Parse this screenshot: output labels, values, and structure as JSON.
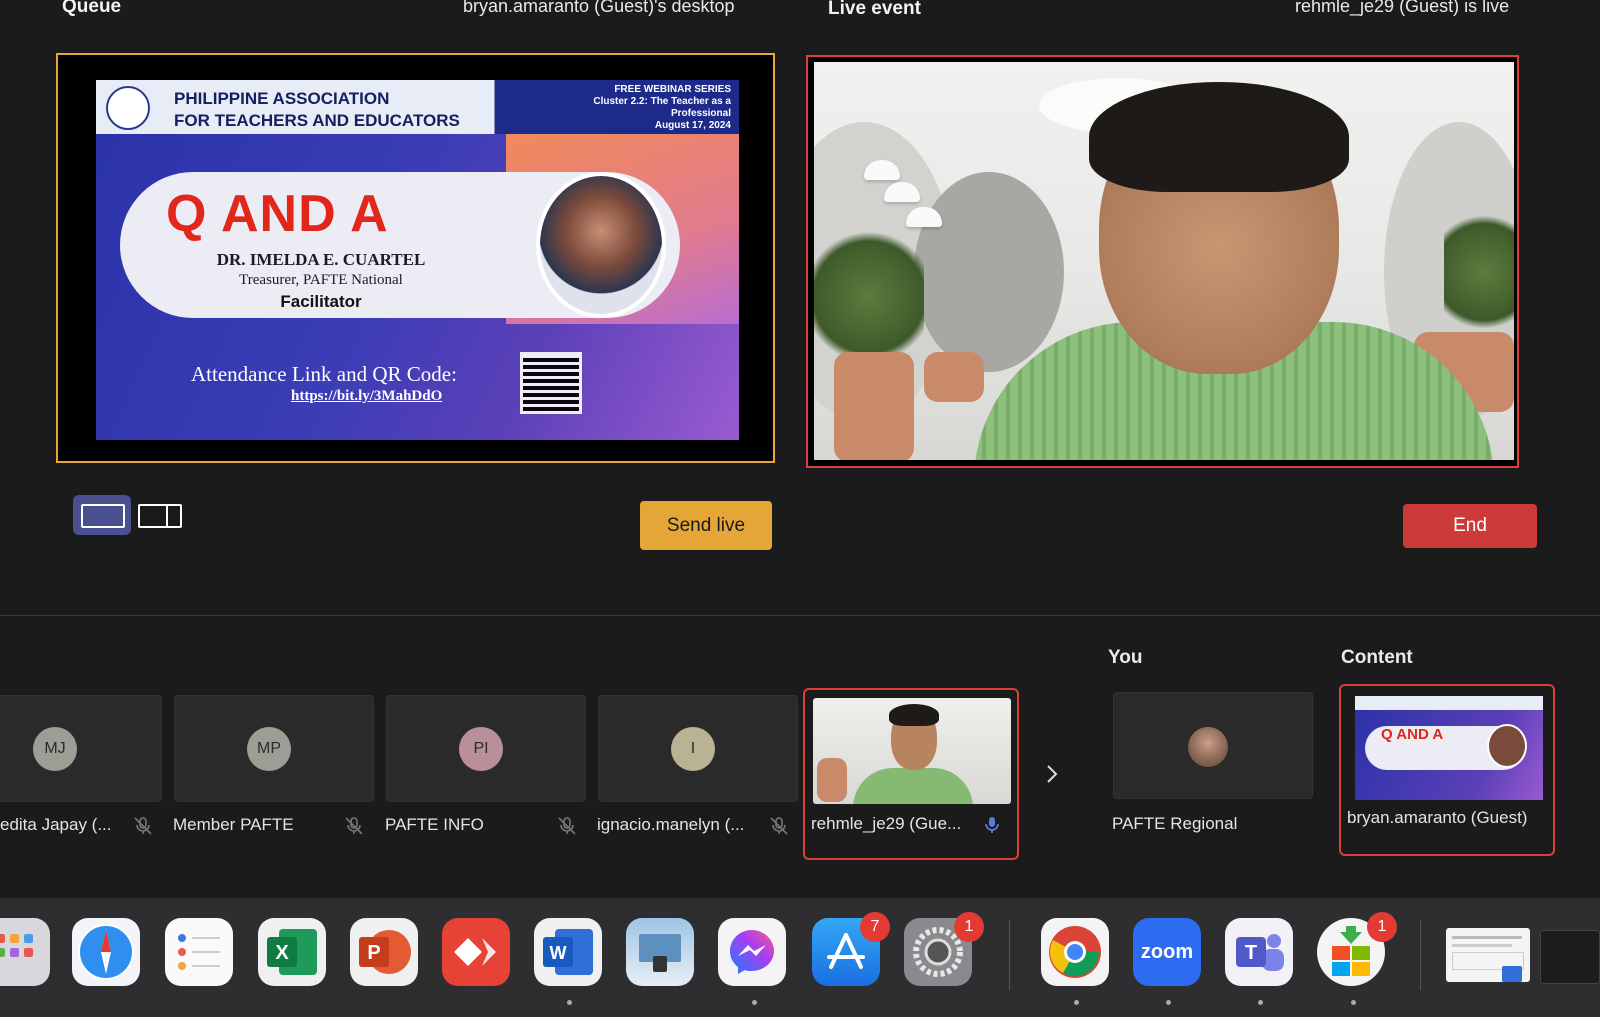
{
  "queue": {
    "title": "Queue",
    "source": "bryan.amaranto (Guest)'s desktop"
  },
  "live": {
    "title": "Live event",
    "source": "rehmle_je29 (Guest) is live"
  },
  "slide": {
    "org_line1": "PHILIPPINE ASSOCIATION",
    "org_line2": "FOR TEACHERS AND EDUCATORS",
    "series": "FREE WEBINAR SERIES\nCluster 2.2: The Teacher as a\nProfessional\nAugust 17, 2024",
    "heading": "Q AND A",
    "name": "DR. IMELDA E. CUARTEL",
    "role": "Treasurer, PAFTE National",
    "facilitator": "Facilitator",
    "attendance": "Attendance Link and QR Code:",
    "link": "https://bit.ly/3MahDdO"
  },
  "controls": {
    "send_live": "Send live",
    "end": "End"
  },
  "participants": [
    {
      "initials": "MJ",
      "name": "edita Japay (...",
      "avatar_color": "#9d9d95"
    },
    {
      "initials": "MP",
      "name": "Member PAFTE",
      "avatar_color": "#9d9d95"
    },
    {
      "initials": "PI",
      "name": "PAFTE INFO",
      "avatar_color": "#b9909a"
    },
    {
      "initials": "I",
      "name": "ignacio.manelyn (...",
      "avatar_color": "#b9b293"
    }
  ],
  "live_participant": {
    "name": "rehmle_je29 (Gue..."
  },
  "you": {
    "label": "You",
    "name": "PAFTE Regional"
  },
  "content": {
    "label": "Content",
    "name": "bryan.amaranto (Guest)",
    "thumb_heading": "Q AND A"
  },
  "dock": {
    "zoom_label": "zoom",
    "badges": {
      "app_store": "7",
      "settings": "1",
      "installer": "1"
    }
  },
  "colors": {
    "accent_queue": "#e3a73a",
    "accent_live": "#d9403c",
    "send_live": "#e5a638",
    "end": "#cc3a3a"
  }
}
